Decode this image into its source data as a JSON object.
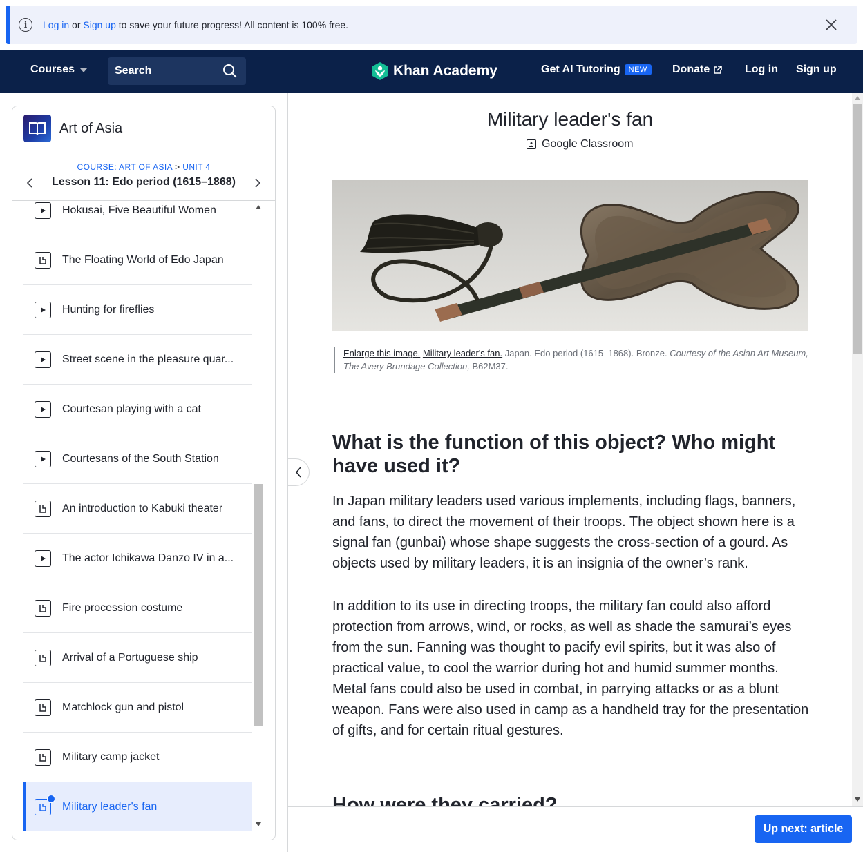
{
  "banner": {
    "login": "Log in",
    "or": "or",
    "signup": "Sign up",
    "rest": "to save your future progress! All content is 100% free."
  },
  "header": {
    "courses": "Courses",
    "search_placeholder": "Search",
    "logo": "Khan Academy",
    "ai_tutoring": "Get AI Tutoring",
    "new_badge": "NEW",
    "donate": "Donate",
    "login": "Log in",
    "signup": "Sign up"
  },
  "sidebar": {
    "course_title": "Art of Asia",
    "breadcrumb_course": "COURSE: ART OF ASIA",
    "breadcrumb_sep": ">",
    "breadcrumb_unit": "UNIT 4",
    "lesson_title": "Lesson 11: Edo period (1615–1868)",
    "items": [
      {
        "label": "Hokusai, Five Beautiful Women",
        "type": "video"
      },
      {
        "label": "The Floating World of Edo Japan",
        "type": "article"
      },
      {
        "label": "Hunting for fireflies",
        "type": "video"
      },
      {
        "label": "Street scene in the pleasure quar...",
        "type": "video"
      },
      {
        "label": "Courtesan playing with a cat",
        "type": "video"
      },
      {
        "label": "Courtesans of the South Station",
        "type": "video"
      },
      {
        "label": "An introduction to Kabuki theater",
        "type": "article"
      },
      {
        "label": "The actor Ichikawa Danzo IV in a...",
        "type": "video"
      },
      {
        "label": "Fire procession costume",
        "type": "article"
      },
      {
        "label": "Arrival of a Portuguese ship",
        "type": "article"
      },
      {
        "label": "Matchlock gun and pistol",
        "type": "article"
      },
      {
        "label": "Military camp jacket",
        "type": "article"
      },
      {
        "label": "Military leader's fan",
        "type": "article",
        "active": true
      }
    ]
  },
  "article": {
    "title": "Military leader's fan",
    "google_classroom": "Google Classroom",
    "caption": {
      "enlarge": "Enlarge this image.",
      "link_title": "Military leader's fan.",
      "details": "Japan. Edo period (1615–1868). Bronze.",
      "courtesy": "Courtesy of the Asian Art Museum, The Avery Brundage Collection,",
      "accession": "B62M37."
    },
    "heading1": "What is the function of this object? Who might have used it?",
    "para1": "In Japan military leaders used various implements, including flags, banners, and fans, to direct the movement of their troops. The object shown here is a signal fan (gunbai) whose shape suggests the cross-section of a gourd. As objects used by military leaders, it is an insignia of the owner’s rank.",
    "para2": "In addition to its use in directing troops, the military fan could also afford protection from arrows, wind, or rocks, as well as shade the samurai’s eyes from the sun. Fanning was thought to pacify evil spirits, but it was also of practical value, to cool the warrior during hot and humid summer months. Metal fans could also be used in combat, in parrying attacks or as a blunt weapon. Fans were also used in camp as a handheld tray for the presentation of gifts, and for certain ritual gestures.",
    "heading2": "How were they carried?"
  },
  "footer": {
    "up_next": "Up next: article"
  },
  "colors": {
    "brand_blue": "#1865f2",
    "header_navy": "#0b2149",
    "logo_green": "#14bf96"
  }
}
